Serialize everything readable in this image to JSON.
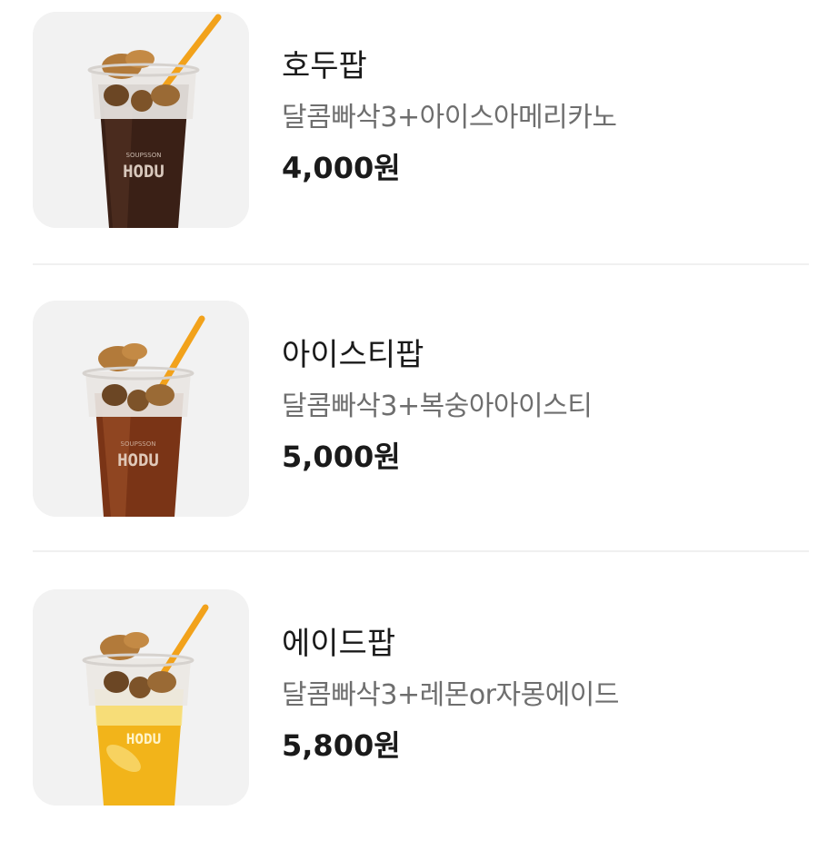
{
  "menu": {
    "items": [
      {
        "name": "호두팝",
        "description": "달콤빠삭3+아이스아메리카노",
        "price": "4,000원",
        "image": {
          "icon": "iced-americano-cup-with-walnut-pastries",
          "cup_brand_top": "SOUPSSON",
          "cup_brand": "HODU",
          "drink_color": "#3a2016",
          "drink_highlight": "#5a3526"
        }
      },
      {
        "name": "아이스티팝",
        "description": "달콤빠삭3+복숭아아이스티",
        "price": "5,000원",
        "image": {
          "icon": "peach-iced-tea-cup-with-walnut-pastries",
          "cup_brand_top": "SOUPSSON",
          "cup_brand": "HODU",
          "drink_color": "#7a3416",
          "drink_highlight": "#a0542c"
        }
      },
      {
        "name": "에이드팝",
        "description": "달콤빠삭3+레몬or자몽에이드",
        "price": "5,800원",
        "image": {
          "icon": "lemon-ade-cup-with-walnut-pastries",
          "cup_brand_top": "",
          "cup_brand": "HODU",
          "drink_color": "#f2b41a",
          "drink_highlight": "#f8e48a"
        }
      }
    ]
  },
  "colors": {
    "background": "#ffffff",
    "thumb_background": "#f2f2f2",
    "divider": "#f0f0f0",
    "straw": "#f2a21b",
    "pastry": "#b27a3a"
  }
}
